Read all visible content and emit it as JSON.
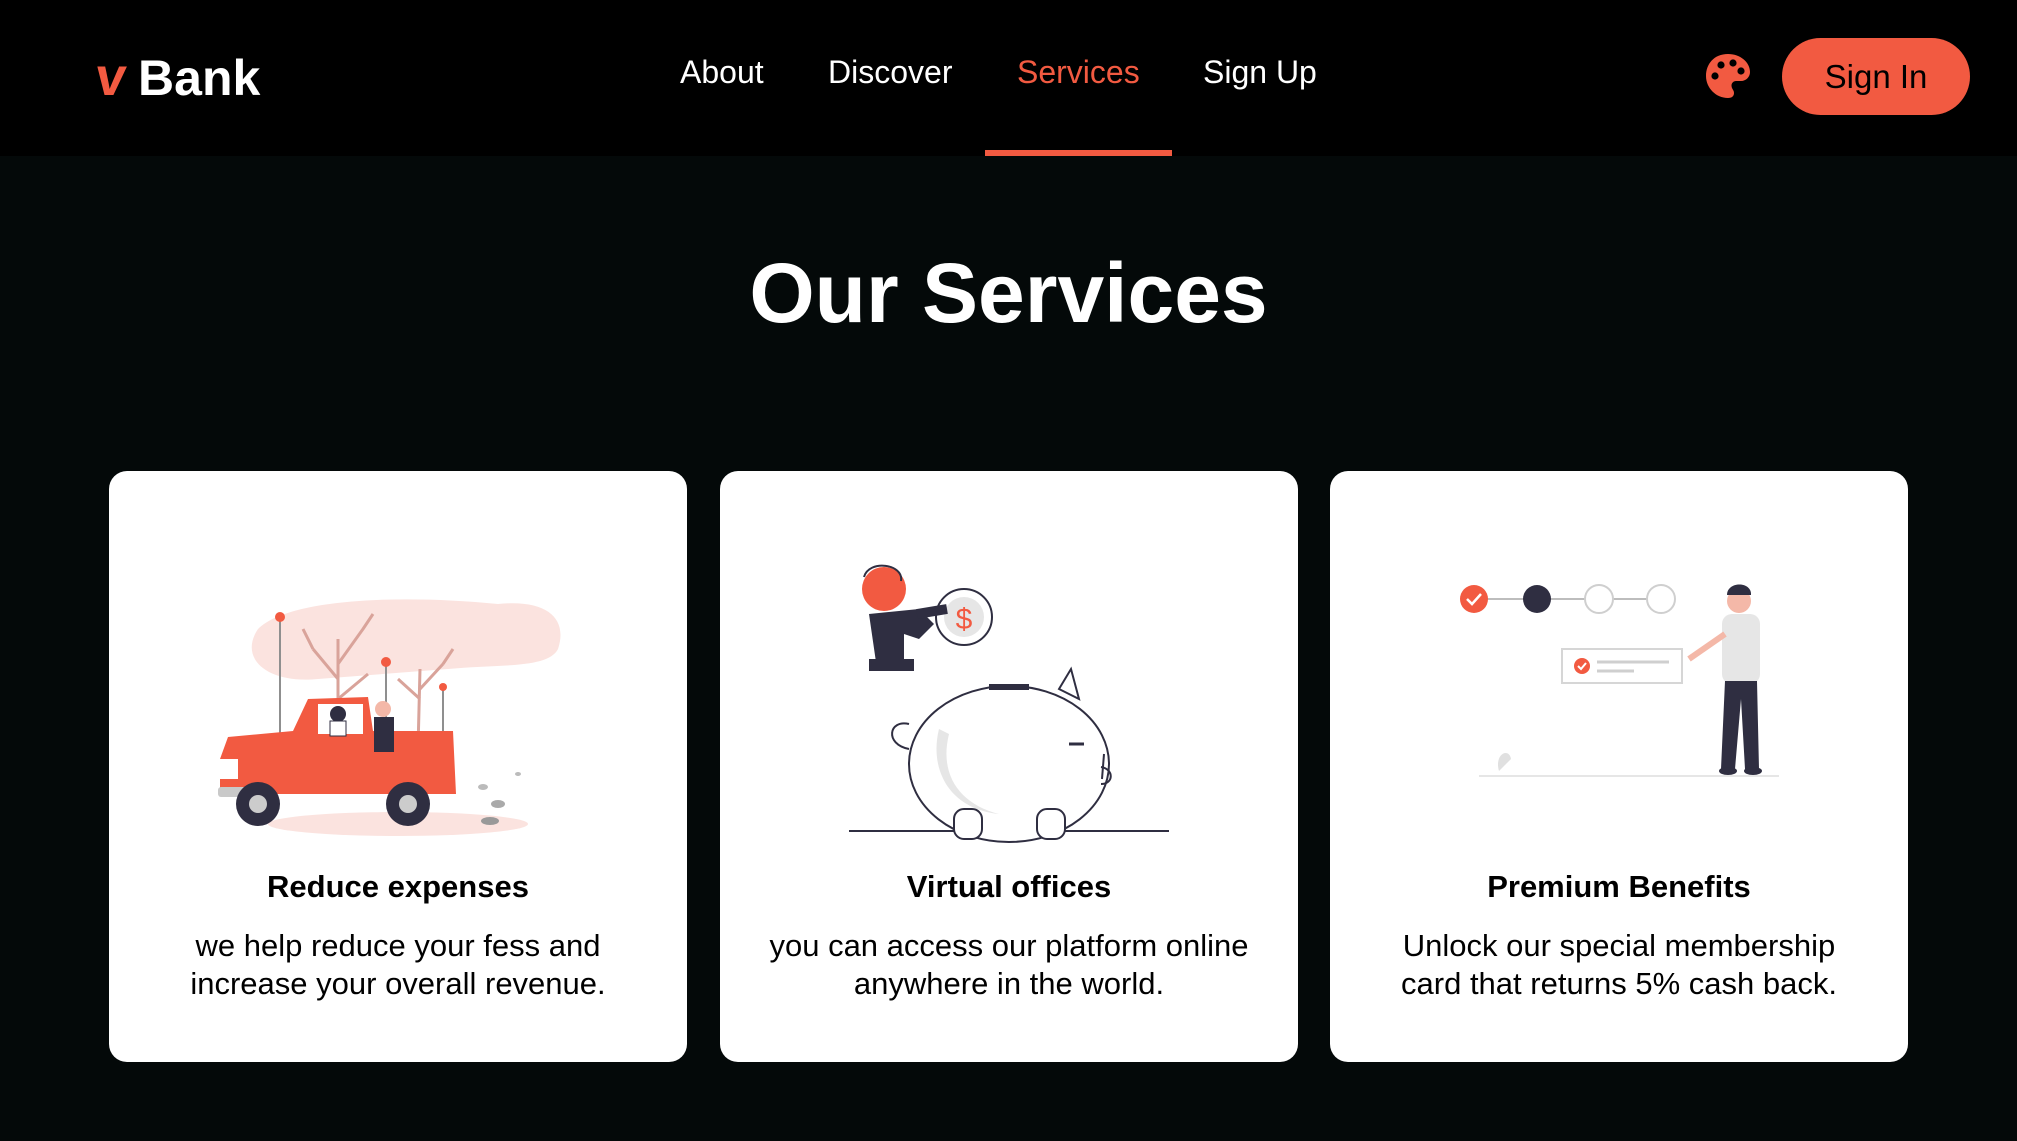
{
  "brand": {
    "mark": "v",
    "name": "Bank"
  },
  "nav": {
    "items": [
      {
        "label": "About"
      },
      {
        "label": "Discover"
      },
      {
        "label": "Services"
      },
      {
        "label": "Sign Up"
      }
    ],
    "active": "Services"
  },
  "header": {
    "theme_icon": "palette-icon",
    "signin_label": "Sign In"
  },
  "services": {
    "title": "Our Services",
    "cards": [
      {
        "title": "Reduce expenses",
        "description": "we help reduce your fess and increase your overall revenue.",
        "illustration": "car-illustration"
      },
      {
        "title": "Virtual offices",
        "description": "you can access our platform online anywhere in the world.",
        "illustration": "piggy-bank-illustration"
      },
      {
        "title": "Premium Benefits",
        "description": "Unlock our special membership card that returns 5% cash back.",
        "illustration": "progress-steps-illustration"
      }
    ]
  },
  "colors": {
    "accent": "#f25a41",
    "background": "#040909",
    "navbar": "#000000",
    "card": "#ffffff"
  }
}
